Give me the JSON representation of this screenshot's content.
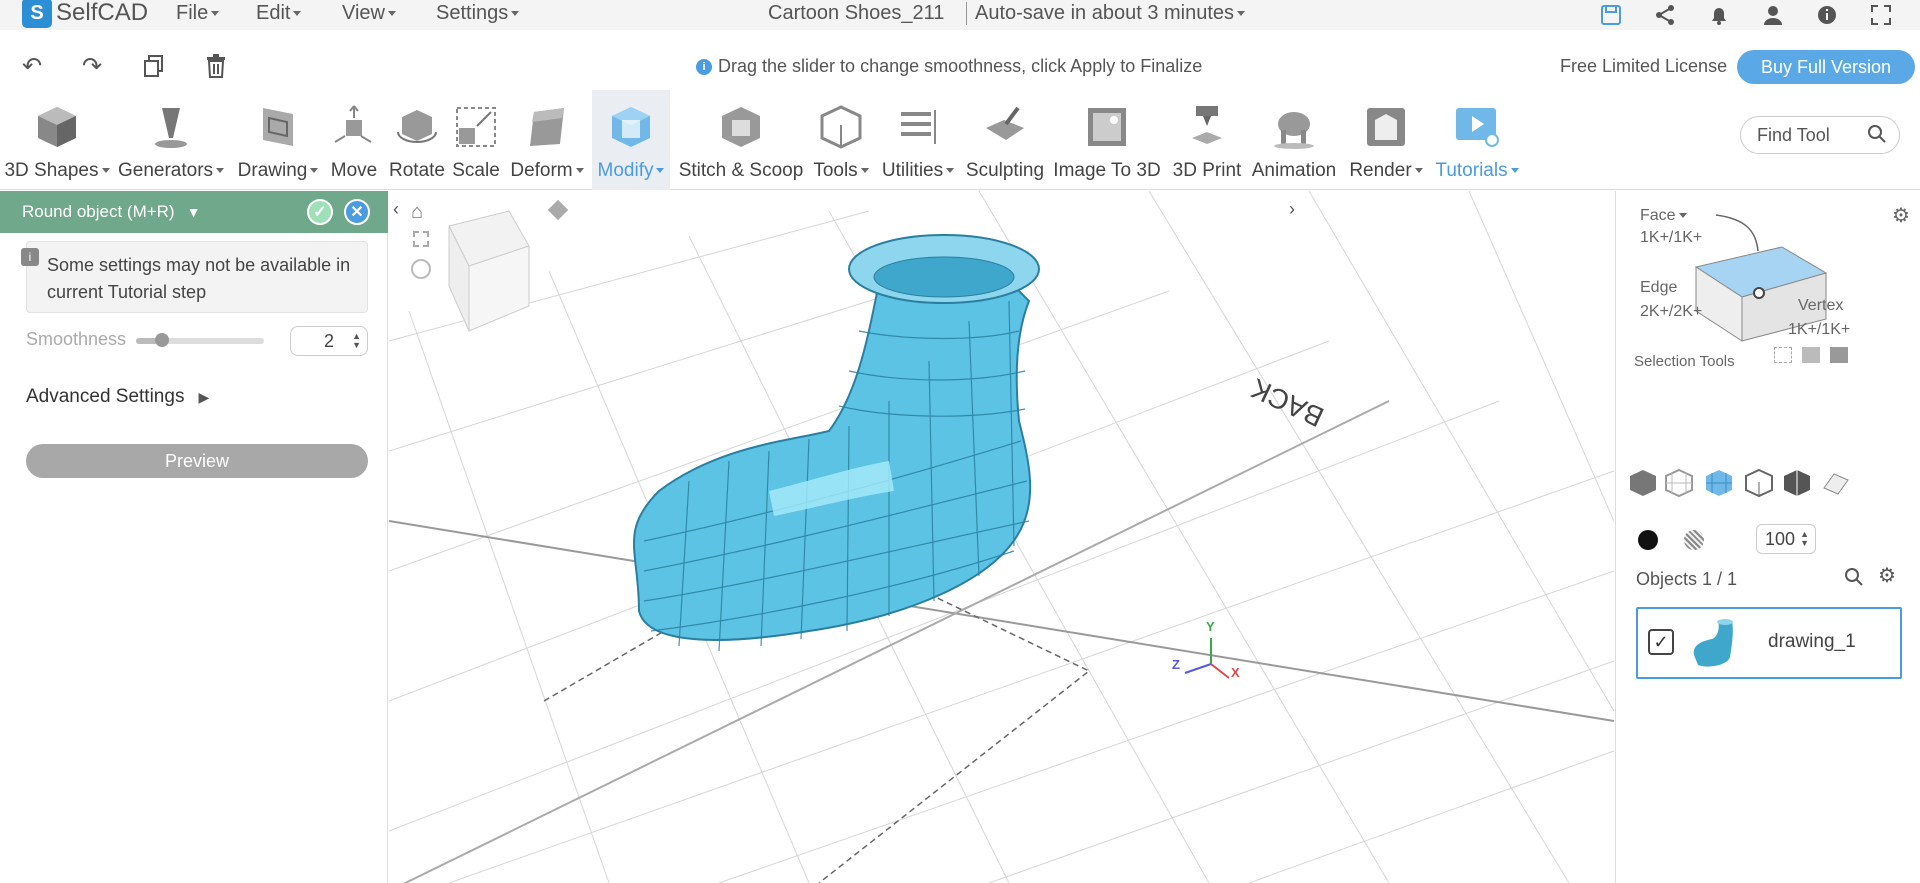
{
  "app": {
    "logo_text": "SelfCAD",
    "logo_mark": "S"
  },
  "menu": {
    "file": "File",
    "edit": "Edit",
    "view": "View",
    "settings": "Settings"
  },
  "doc": {
    "title": "Cartoon Shoes_211",
    "autosave": "Auto-save in about 3 minutes"
  },
  "hint": "Drag the slider to change smoothness, click Apply to Finalize",
  "license": {
    "text": "Free Limited License",
    "buy": "Buy Full Version"
  },
  "toolbar": {
    "items": [
      "3D Shapes",
      "Generators",
      "Drawing",
      "Move",
      "Rotate",
      "Scale",
      "Deform",
      "Modify",
      "Stitch & Scoop",
      "Tools",
      "Utilities",
      "Sculpting",
      "Image To 3D",
      "3D Print",
      "Animation",
      "Render",
      "Tutorials"
    ],
    "active": "Modify",
    "find_placeholder": "Find Tool"
  },
  "panel": {
    "title": "Round object (M+R)",
    "notice": "Some settings may not be available in current Tutorial step",
    "smoothness_label": "Smoothness",
    "smoothness_value": "2",
    "smoothness_level": 0.2,
    "advanced": "Advanced Settings",
    "preview": "Preview"
  },
  "viewport": {
    "back_label": "BACK",
    "axis": {
      "x": "X",
      "y": "Y",
      "z": "Z"
    },
    "mesh_color": "#5cc3e4"
  },
  "right": {
    "face_label": "Face",
    "face_count": "1K+/1K+",
    "edge_label": "Edge",
    "edge_count": "2K+/2K+",
    "vertex_label": "Vertex",
    "vertex_count": "1K+/1K+",
    "selection_tools": "Selection Tools",
    "opacity": "100",
    "objects_label": "Objects 1 / 1",
    "object_name": "drawing_1"
  },
  "colors": {
    "accent": "#4a9be0",
    "panel_header": "#6fa88a",
    "mesh": "#5cc3e4"
  }
}
